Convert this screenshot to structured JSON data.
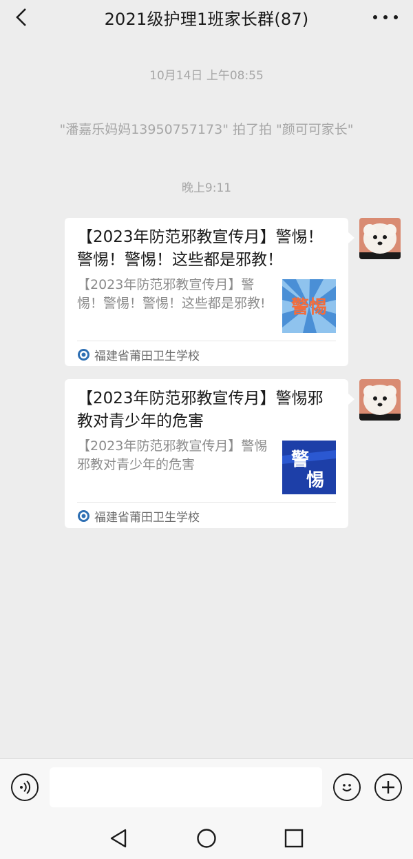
{
  "header": {
    "title": "2021级护理1班家长群(87)",
    "back_icon": "chevron-left-icon",
    "more_icon": "more-dots-icon"
  },
  "chat": {
    "timestamp_1": "10月14日 上午08:55",
    "pat_notice": "\"潘嘉乐妈妈13950757173\" 拍了拍 \"颜可可家长\"",
    "timestamp_2": "晚上9:11",
    "messages": [
      {
        "title": "【2023年防范邪教宣传月】警惕！警惕！警惕！这些都是邪教！",
        "description": "【2023年防范邪教宣传月】警惕！警惕！警惕！这些都是邪教!",
        "thumb_text": "警惕",
        "source": "福建省莆田卫生学校",
        "thumb_colors": [
          "#4a8fd6",
          "#f26d3d"
        ]
      },
      {
        "title": "【2023年防范邪教宣传月】警惕邪教对青少年的危害",
        "description": "【2023年防范邪教宣传月】警惕邪教对青少年的危害",
        "thumb_text": "警惕",
        "source": "福建省莆田卫生学校",
        "thumb_colors": [
          "#1d3fa8",
          "#ffffff"
        ]
      }
    ]
  },
  "bottom_bar": {
    "voice_icon": "voice-icon",
    "input_placeholder": "",
    "emoji_icon": "emoji-icon",
    "plus_icon": "plus-icon"
  },
  "nav_bar": {
    "back_icon": "nav-back-icon",
    "home_icon": "nav-home-icon",
    "recents_icon": "nav-recents-icon"
  },
  "colors": {
    "background": "#ededed",
    "bubble": "#ffffff",
    "system_text": "#a6a6a6"
  }
}
